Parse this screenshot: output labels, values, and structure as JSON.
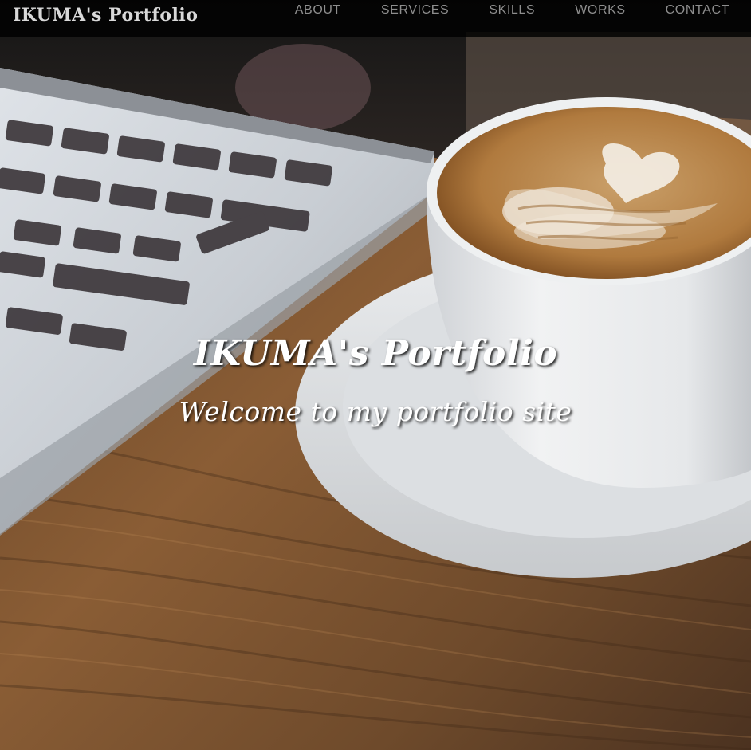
{
  "navbar": {
    "brand": "IKUMA's Portfolio",
    "items": [
      {
        "label": "ABOUT"
      },
      {
        "label": "SERVICES"
      },
      {
        "label": "SKILLS"
      },
      {
        "label": "WORKS"
      },
      {
        "label": "CONTACT"
      }
    ]
  },
  "hero": {
    "title": "IKUMA's Portfolio",
    "subtitle": "Welcome to my portfolio site",
    "background": "laptop-and-latte-photo"
  },
  "colors": {
    "navbar_bg": "#000000",
    "brand_text": "#d9d9d9",
    "nav_text": "#8e8e8e",
    "hero_text": "#ffffff"
  }
}
